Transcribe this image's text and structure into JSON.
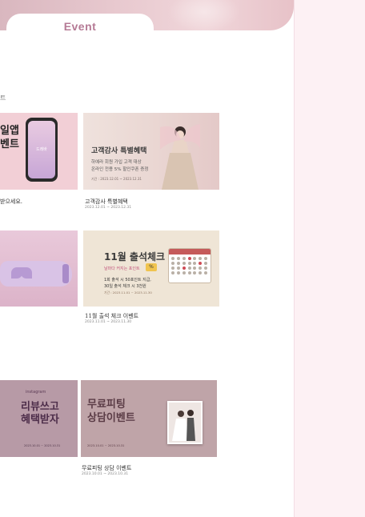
{
  "header": {
    "event_tab": "Event"
  },
  "side_label": "트",
  "cards": [
    {
      "banner_big": [
        "일앱",
        "벤트"
      ],
      "phone_brand": "드레바",
      "caption_title": "받으세요.",
      "caption_date": ""
    },
    {
      "banner_big": "고객감사 특별혜택",
      "banner_line1": "하예라 회원 가입 고객 대상",
      "banner_line2": "온라인 전용 5% 할인쿠폰 증정",
      "banner_line3": "기간 : 2023.12.01 ~ 2023.12.31",
      "caption_title": "고객감사 특별혜택",
      "caption_date": "2023.12.01 ~ 2023.12.31"
    },
    {
      "caption_title": "",
      "caption_date": ""
    },
    {
      "banner_big": "11월 출석체크",
      "banner_badge": "날마다 커지는 포인트",
      "banner_pct": "%",
      "banner_line1": "1회 출석 시 50포인트 지급,",
      "banner_line2": "30일 출석 체크 시 3천원",
      "banner_line3": "기간 : 2023.11.01 ~ 2023.11.30",
      "caption_title": "11월 출석 체크 이벤트",
      "caption_date": "2023.11.01 ~ 2023.11.30"
    },
    {
      "banner_ig": "instagram",
      "banner_big": [
        "리뷰쓰고",
        "혜택받자"
      ],
      "banner_line3": "2023.10.01 ~ 2023.10.31",
      "caption_title": "",
      "caption_date": ""
    },
    {
      "banner_big": [
        "무료피팅",
        "상담이벤트"
      ],
      "banner_line3": "2023.10.01 ~ 2023.10.31",
      "caption_title": "무료피팅 상담 이벤트",
      "caption_date": "2023.10.01 ~ 2023.10.31"
    }
  ],
  "colors": {
    "accent": "#b57a95",
    "side_strip": "#fdf1f4"
  }
}
